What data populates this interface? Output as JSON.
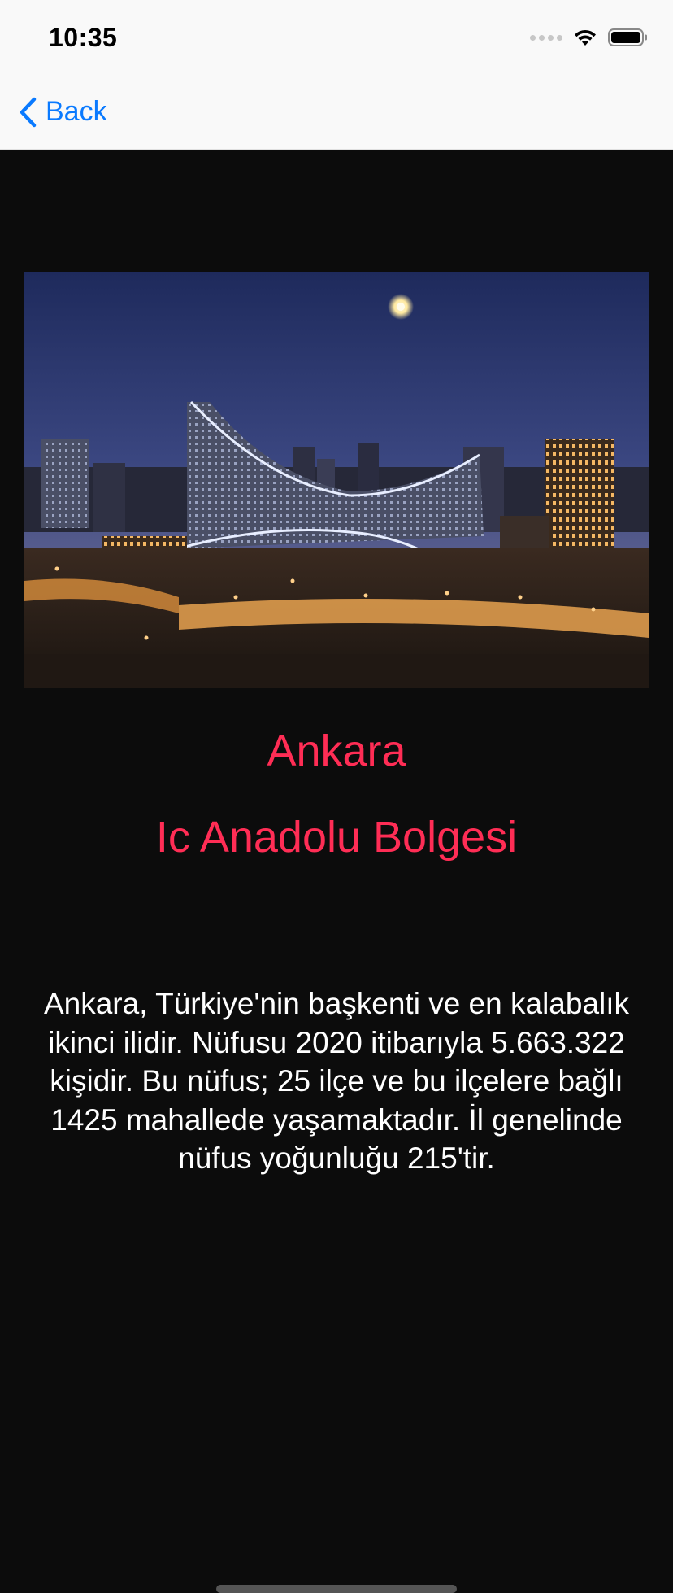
{
  "status_bar": {
    "time": "10:35"
  },
  "nav": {
    "back_label": "Back"
  },
  "city": {
    "name": "Ankara",
    "region": "Ic Anadolu Bolgesi",
    "description": "Ankara, Türkiye'nin başkenti ve en kalabalık ikinci ilidir. Nüfusu 2020 itibarıyla 5.663.322 kişidir. Bu nüfus; 25 ilçe ve bu ilçelere bağlı 1425 mahallede yaşamaktadır. İl genelinde nüfus yoğunluğu 215'tir."
  },
  "colors": {
    "accent": "#ff2d55",
    "link": "#0a7aff",
    "background": "#0c0c0c"
  }
}
